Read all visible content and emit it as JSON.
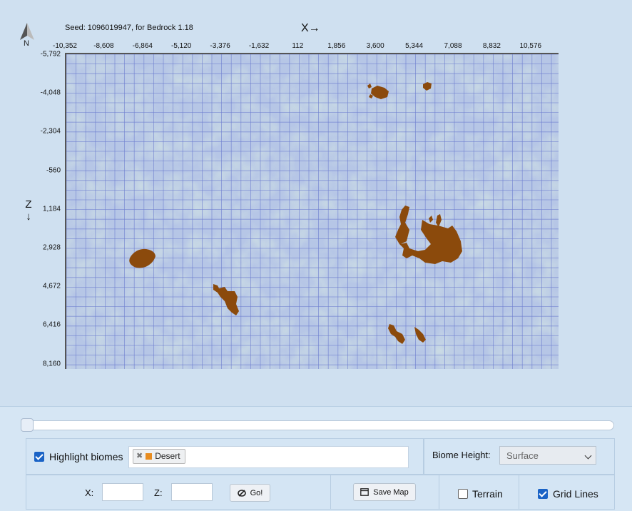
{
  "header": {
    "seed_text": "Seed: 1096019947, for Bedrock 1.18",
    "compass_label": "N",
    "x_axis_title": "X→",
    "z_axis_title": "Z ↓"
  },
  "axes": {
    "x_ticks": [
      "-10,352",
      "-8,608",
      "-6,864",
      "-5,120",
      "-3,376",
      "-1,632",
      "112",
      "1,856",
      "3,600",
      "5,344",
      "7,088",
      "8,832",
      "10,576"
    ],
    "z_ticks": [
      "-5,792",
      "-4,048",
      "-2,304",
      "-560",
      "1,184",
      "2,928",
      "4,672",
      "6,416",
      "8,160"
    ]
  },
  "map": {
    "background_color": "#b6c6e6",
    "grid_color": "#6f7fd0",
    "highlight_color": "#8b4a0c",
    "grid_lines": true
  },
  "controls": {
    "highlight_label": "Highlight biomes",
    "highlight_checked": true,
    "selected_biome": "Desert",
    "selected_biome_color": "#e88c1f",
    "biome_height_label": "Biome Height:",
    "biome_height_value": "Surface",
    "x_label": "X:",
    "z_label": "Z:",
    "x_value": "",
    "z_value": "",
    "go_label": "Go!",
    "save_label": "Save Map",
    "terrain_label": "Terrain",
    "terrain_checked": false,
    "grid_label": "Grid Lines",
    "grid_checked": true
  }
}
